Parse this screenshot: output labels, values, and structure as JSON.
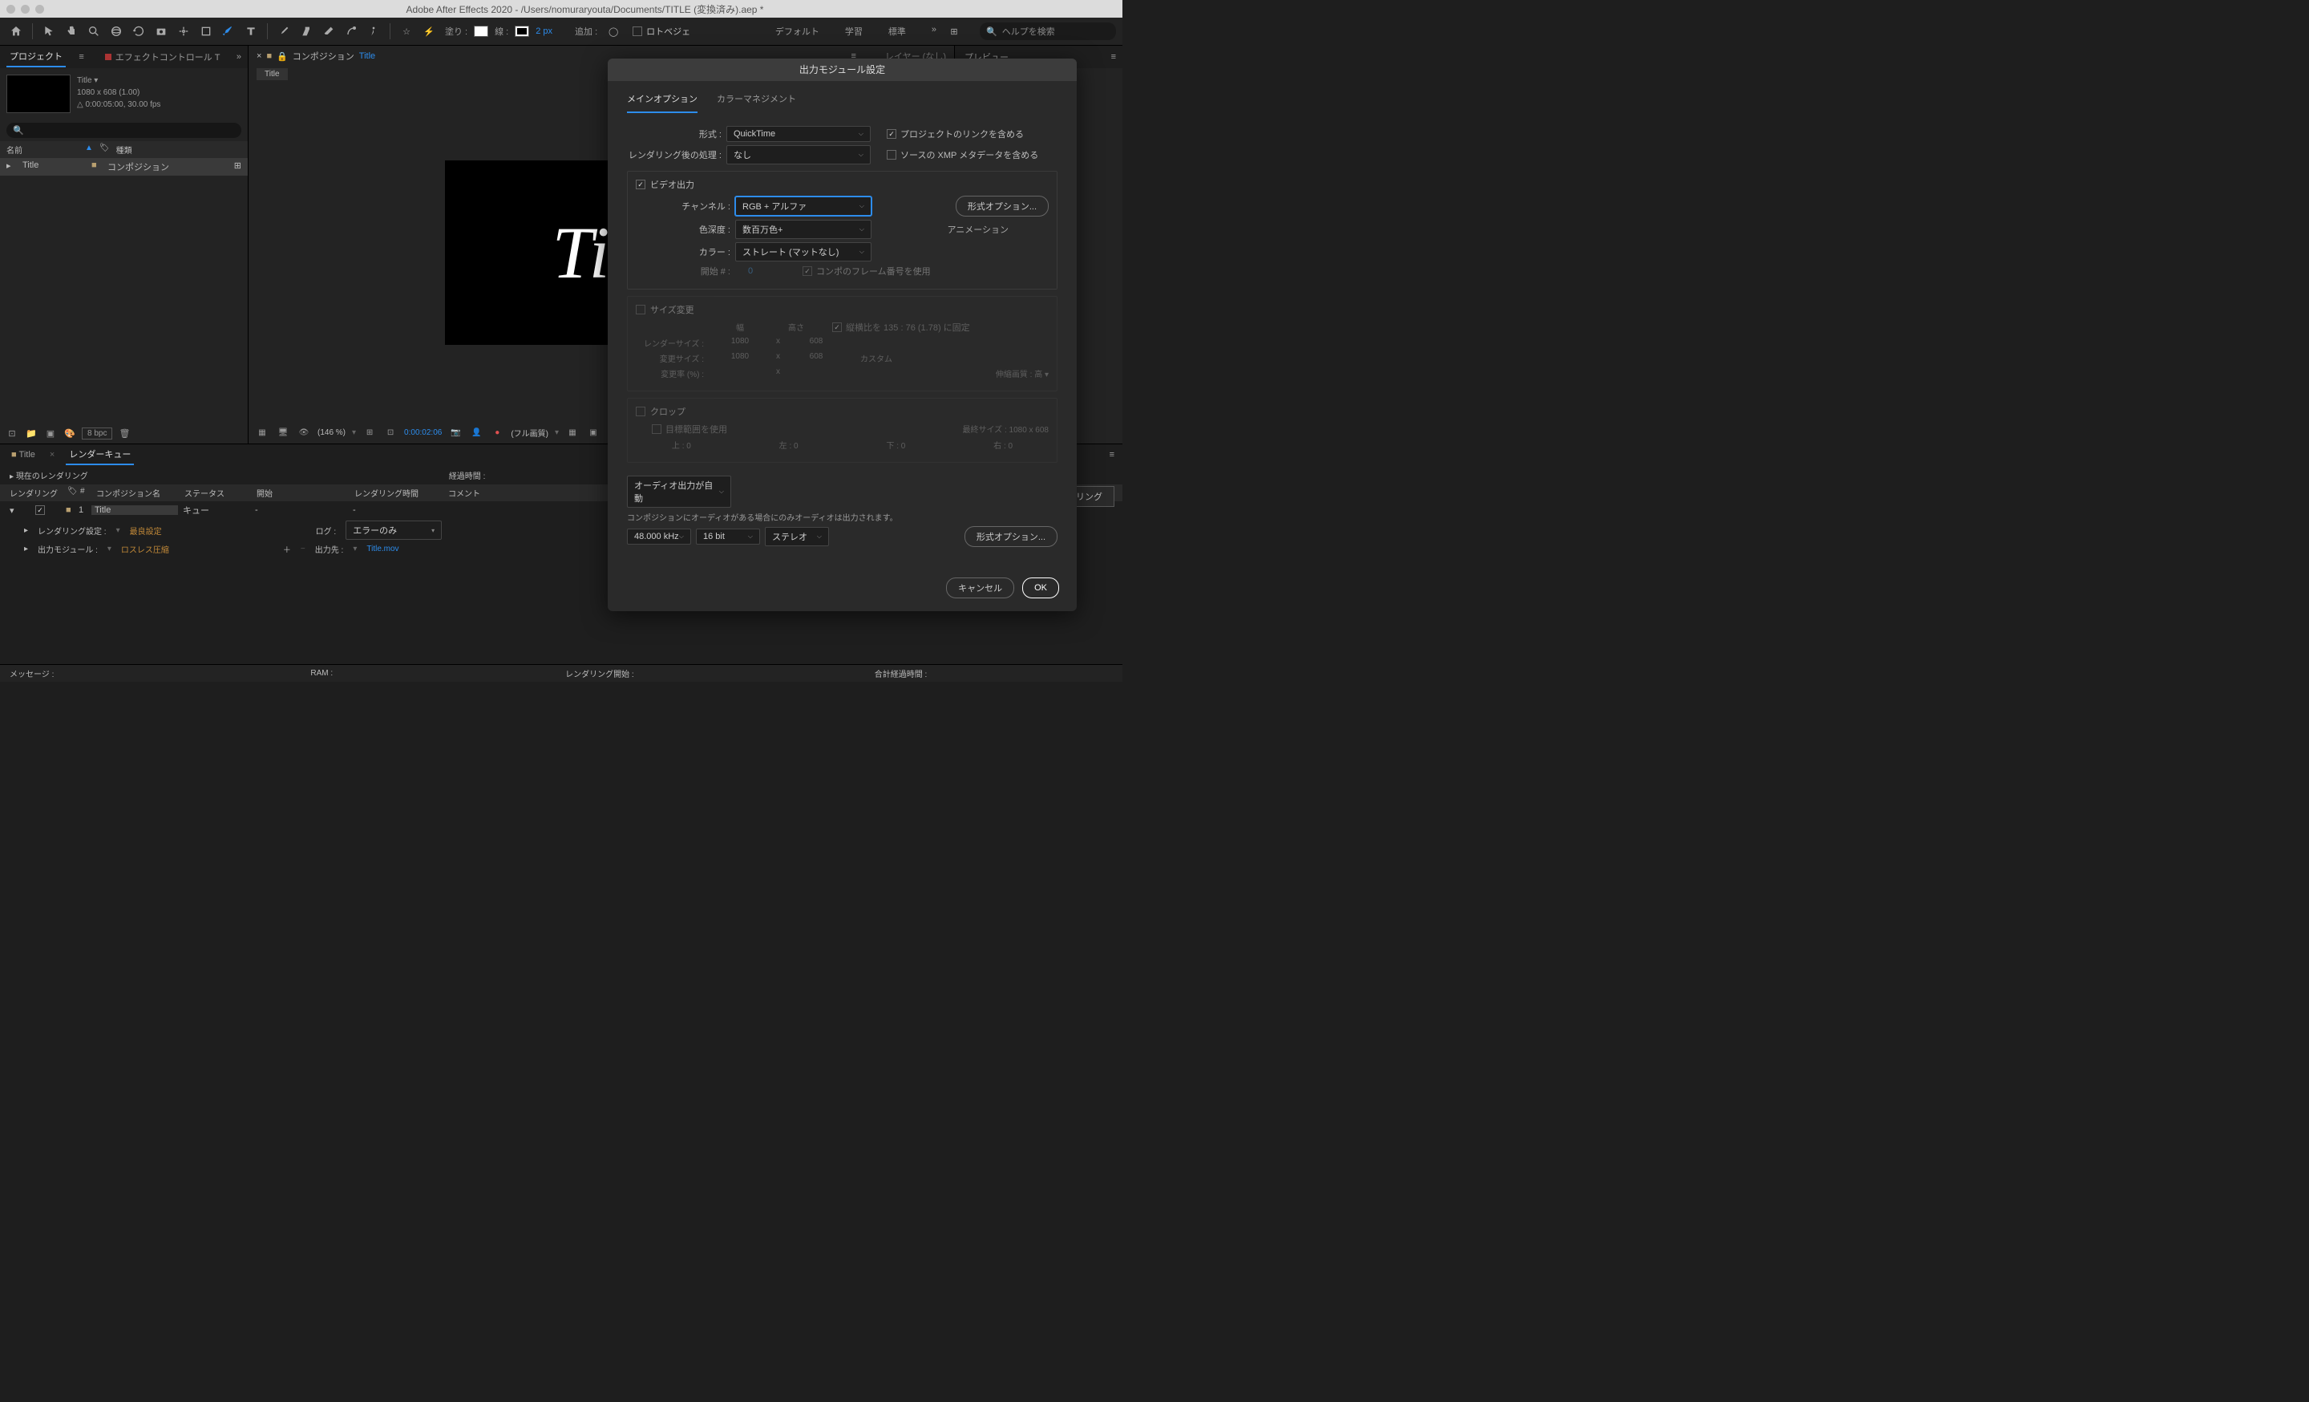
{
  "titlebar": "Adobe After Effects 2020 - /Users/nomuraryouta/Documents/TITLE (変換済み).aep *",
  "toolbar": {
    "fill_label": "塗り :",
    "stroke_label": "線 :",
    "stroke_px": "2 px",
    "add_label": "追加 :",
    "rotobezier": "ロトベジェ"
  },
  "workspaces": [
    "デフォルト",
    "学習",
    "標準"
  ],
  "search_placeholder": "ヘルプを検索",
  "project": {
    "tab1": "プロジェクト",
    "tab2": "エフェクトコントロール T",
    "info_name": "Title ▾",
    "info_res": "1080 x 608 (1.00)",
    "info_dur": "△ 0:00:05:00, 30.00 fps",
    "col_name": "名前",
    "col_type": "種類",
    "row_name": "Title",
    "row_type": "コンポジション",
    "bpc": "8 bpc"
  },
  "comp": {
    "tab_label": "コンポジション",
    "tab_link": "Title",
    "layer_tab": "レイヤー (なし)",
    "subtab": "Title",
    "canvas_text": "Titl",
    "zoom": "(146 %)",
    "timecode": "0:00:02:06",
    "quality": "(フル画質)"
  },
  "preview": {
    "title": "プレビュー"
  },
  "bottom": {
    "tab1": "Title",
    "tab2": "レンダーキュー",
    "current": "現在のレンダリング",
    "elapsed": "経過時間 :",
    "render_btn": "レンダリング",
    "cols": {
      "render": "レンダリング",
      "num": "#",
      "comp": "コンポジション名",
      "status": "ステータス",
      "start": "開始",
      "time": "レンダリング時間",
      "comment": "コメント"
    },
    "row": {
      "num": "1",
      "comp": "Title",
      "status": "キュー",
      "start": "-",
      "time": "-"
    },
    "render_settings_label": "レンダリング設定 :",
    "render_settings_val": "最良設定",
    "log_label": "ログ :",
    "log_val": "エラーのみ",
    "om_label": "出力モジュール :",
    "om_val": "ロスレス圧縮",
    "out_label": "出力先 :",
    "out_val": "Title.mov"
  },
  "status": {
    "msg": "メッセージ :",
    "ram": "RAM :",
    "start": "レンダリング開始 :",
    "total": "合計経過時間 :"
  },
  "modal": {
    "title": "出力モジュール設定",
    "tab_main": "メインオプション",
    "tab_color": "カラーマネジメント",
    "format_label": "形式 :",
    "format_val": "QuickTime",
    "post_label": "レンダリング後の処理 :",
    "post_val": "なし",
    "include_link": "プロジェクトのリンクを含める",
    "include_xmp": "ソースの XMP メタデータを含める",
    "video_out": "ビデオ出力",
    "channel_label": "チャンネル :",
    "channel_val": "RGB + アルファ",
    "format_opts": "形式オプション...",
    "depth_label": "色深度 :",
    "depth_val": "数百万色+",
    "animation_label": "アニメーション",
    "color_label": "カラー :",
    "color_val": "ストレート (マットなし)",
    "start_label": "開始 # :",
    "start_val": "0",
    "use_comp_frame": "コンポのフレーム番号を使用",
    "resize": "サイズ変更",
    "width": "幅",
    "height": "高さ",
    "lock_aspect": "縦横比を 135 : 76 (1.78) に固定",
    "render_size": "レンダーサイズ :",
    "r_w": "1080",
    "r_h": "608",
    "change_size": "変更サイズ :",
    "c_w": "1080",
    "c_h": "608",
    "custom": "カスタム",
    "change_pct": "変更率 (%) :",
    "stretch_q": "伸縮画質 :",
    "stretch_val": "高",
    "crop": "クロップ",
    "use_roi": "目標範囲を使用",
    "final_size": "最終サイズ : 1080 x 608",
    "top": "上 :",
    "left": "左 :",
    "bottom": "下 :",
    "right": "右 :",
    "audio_mode": "オーディオ出力が自動",
    "audio_note": "コンポジションにオーディオがある場合にのみオーディオは出力されます。",
    "audio_rate": "48.000 kHz",
    "audio_bit": "16 bit",
    "audio_chan": "ステレオ",
    "cancel": "キャンセル",
    "ok": "OK"
  }
}
